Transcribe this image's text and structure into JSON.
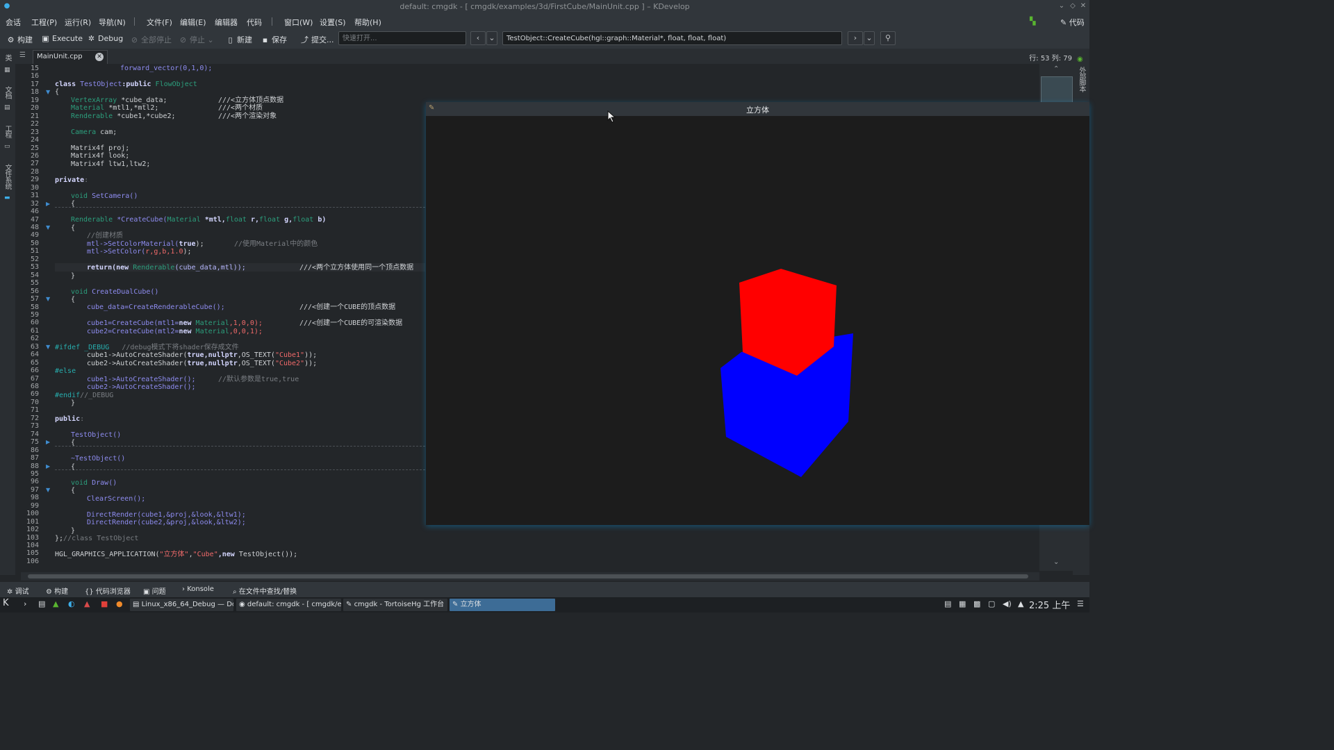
{
  "window": {
    "title": "default: cmgdk - [ cmgdk/examples/3d/FirstCube/MainUnit.cpp ] – KDevelop"
  },
  "menubar": {
    "items": [
      "会话",
      "工程(P)",
      "运行(R)",
      "导航(N)",
      "文件(F)",
      "编辑(E)",
      "编辑器",
      "代码",
      "窗口(W)",
      "设置(S)",
      "帮助(H)"
    ],
    "right_label": "代码"
  },
  "toolbar": {
    "build": "构建",
    "execute": "Execute",
    "debug": "Debug",
    "stop_all": "全部停止",
    "stop": "停止",
    "new": "新建",
    "save": "保存",
    "commit": "提交...",
    "quickopen_placeholder": "快速打开...",
    "context_function": "TestObject::CreateCube(hgl::graph::Material*, float, float, float)"
  },
  "left_dock": {
    "tabs": [
      "类",
      "文档",
      "工程",
      "文件系统"
    ]
  },
  "right_dock": {
    "tabs": [
      "外部脚本"
    ]
  },
  "editor": {
    "tab_filename": "MainUnit.cpp",
    "position": "行: 53 列: 79",
    "line_numbers": [
      "15",
      "16",
      "17",
      "18",
      "19",
      "20",
      "21",
      "22",
      "23",
      "24",
      "25",
      "26",
      "27",
      "28",
      "29",
      "30",
      "31",
      "32",
      "46",
      "47",
      "48",
      "49",
      "50",
      "51",
      "52",
      "53",
      "54",
      "55",
      "56",
      "57",
      "58",
      "59",
      "60",
      "61",
      "62",
      "63",
      "64",
      "65",
      "66",
      "67",
      "68",
      "69",
      "70",
      "71",
      "72",
      "73",
      "74",
      "75",
      "86",
      "87",
      "88",
      "95",
      "96",
      "97",
      "98",
      "99",
      "100",
      "101",
      "102",
      "103",
      "104",
      "105",
      "106"
    ],
    "code": {
      "l15": "forward_vector(0,1,0);",
      "l17a": "class",
      "l17b": "TestObject",
      "l17c": ":public",
      "l17d": "FlowObject",
      "l19a": "VertexArray",
      "l19b": "*cube_data;",
      "l19c": "///<立方体顶点数据",
      "l20a": "Material",
      "l20b": "*mtl1,*mtl2;",
      "l20c": "///<两个材质",
      "l21a": "Renderable",
      "l21b": "*cube1,*cube2;",
      "l21c": "///<两个渲染对象",
      "l23a": "Camera",
      "l23b": "cam;",
      "l25": "Matrix4f proj;",
      "l26": "Matrix4f look;",
      "l27": "Matrix4f ltw1,ltw2;",
      "l29": "private",
      "l31a": "void",
      "l31b": "SetCamera()",
      "l47a": "Renderable",
      "l47b": "*CreateCube(",
      "l47c": "Material",
      "l47d": "*mtl,",
      "l47e": "float",
      "l47f": "r,",
      "l47g": "g,",
      "l47h": "b)",
      "l49": "//创建材质",
      "l50a": "mtl->SetColorMaterial(",
      "l50b": "true",
      "l50c": ");",
      "l50d": "//使用Material中的颜色",
      "l51a": "mtl->SetColor(",
      "l51b": "r,g,b,1.0",
      "l51c": ");",
      "l53a": "return",
      "l53b": "(new",
      "l53c": "Renderable",
      "l53d": "(cube_data,mtl));",
      "l53e": "///<两个立方体使用同一个顶点数据",
      "l56a": "void",
      "l56b": "CreateDualCube()",
      "l58a": "cube_data=CreateRenderableCube();",
      "l58b": "///<创建一个CUBE的顶点数据",
      "l60a": "cube1=CreateCube(mtl1=",
      "l60b": "new",
      "l60c": "Material",
      "l60d": ",1,0,0);",
      "l60e": "///<创建一个CUBE的可渲染数据",
      "l61a": "cube2=CreateCube(mtl2=",
      "l61b": "new",
      "l61c": "Material",
      "l61d": ",0,0,1);",
      "l63a": "#ifdef _DEBUG",
      "l63b": "//debug模式下将shader保存成文件",
      "l64a": "cube1->AutoCreateShader(",
      "l64b": "true,nullptr",
      "l64c": ",OS_TEXT(",
      "l64d": "\"Cube1\"",
      "l64e": "));",
      "l65a": "cube2->AutoCreateShader(",
      "l65b": "true,nullptr",
      "l65c": ",OS_TEXT(",
      "l65d": "\"Cube2\"",
      "l65e": "));",
      "l66": "#else",
      "l67a": "cube1->AutoCreateShader();",
      "l67b": "//默认参数是true,true",
      "l68": "cube2->AutoCreateShader();",
      "l69a": "#endif",
      "l69b": "//_DEBUG",
      "l72": "public",
      "l74": "TestObject()",
      "l87": "~TestObject()",
      "l96a": "void",
      "l96b": "Draw()",
      "l98": "ClearScreen();",
      "l100": "DirectRender(cube1,&proj,&look,&ltw1);",
      "l101": "DirectRender(cube2,&proj,&look,&ltw2);",
      "l103a": "};",
      "l103b": "//class TestObject",
      "l105a": "HGL_GRAPHICS_APPLICATION(",
      "l105b": "\"立方体\"",
      "l105c": ",",
      "l105d": "\"Cube\"",
      "l105e": ",new",
      "l105f": "TestObject());",
      "brace_open": "{",
      "brace_close": "}"
    }
  },
  "cube_window": {
    "title": "立方体",
    "cube_top_color": "#ff0000",
    "cube_bottom_color": "#0000ff"
  },
  "bottom_tabs": [
    "调试",
    "构建",
    "代码浏览器",
    "问题",
    "Konsole",
    "在文件中查找/替换"
  ],
  "taskbar": {
    "tasks": [
      "Linux_x86_64_Debug — Do",
      "default: cmgdk - [ cmgdk/ex",
      "cmgdk - TortoiseHg 工作台",
      "立方体"
    ],
    "clock": "2:25 上午"
  },
  "colors": {
    "accent": "#3daee9",
    "editor_bg": "#232629",
    "keyword": "#d4d6ff",
    "type": "#2c9f7d",
    "function": "#8e8cf0",
    "string": "#f06a6a",
    "comment": "#7a7e83"
  }
}
